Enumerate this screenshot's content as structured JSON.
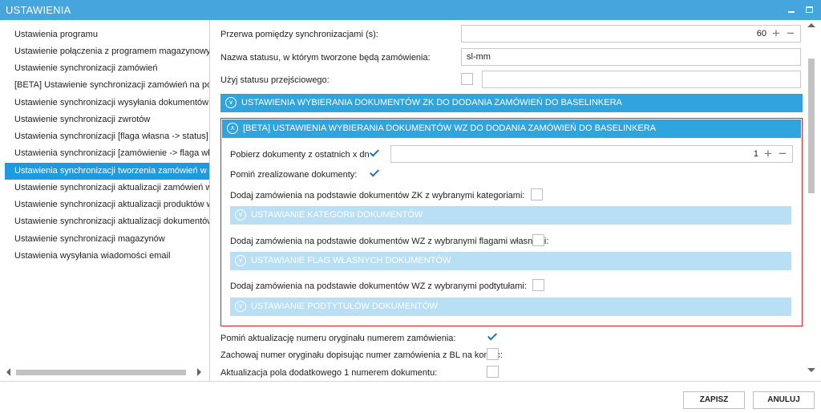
{
  "window": {
    "title": "USTAWIENIA"
  },
  "sidebar": {
    "items": [
      {
        "label": "Ustawienia programu"
      },
      {
        "label": "Ustawienie połączenia z programem magazynowym"
      },
      {
        "label": "Ustawienie synchronizacji zamówień"
      },
      {
        "label": "[BETA] Ustawienie synchronizacji zamówień na podsta"
      },
      {
        "label": "Ustawienie synchronizacji wysyłania dokumentów"
      },
      {
        "label": "Ustawienie synchronizacji zwrotów"
      },
      {
        "label": "Ustawienia synchronizacji [flaga własna -> status]"
      },
      {
        "label": "Ustawienia synchronizacji [zamówienie -> flaga własn"
      },
      {
        "label": "Ustawienia synchronizacji tworzenia zamówień w Base"
      },
      {
        "label": "Ustawienie synchronizacji aktualizacji zamówień w Bas"
      },
      {
        "label": "Ustawienie synchronizacji aktualizacji produktów w Ba"
      },
      {
        "label": "Ustawienie synchronizacji aktualizacji dokumentów"
      },
      {
        "label": "Ustawienie synchronizacji magazynów"
      },
      {
        "label": "Ustawienia wysyłania wiadomości email"
      }
    ],
    "active_index": 8
  },
  "main": {
    "sync_interval": {
      "label": "Przerwa pomiędzy synchronizacjami (s):",
      "value": "60"
    },
    "status_name": {
      "label": "Nazwa statusu, w którym tworzone będą zamówienia:",
      "value": "sl-mm"
    },
    "transitional_status": {
      "label": "Użyj statusu przejściowego:",
      "checked": false,
      "value": ""
    },
    "zk_section": {
      "title": "USTAWIENIA WYBIERANIA DOKUMENTÓW ZK DO DODANIA ZAMÓWIEŃ DO BASELINKERA"
    },
    "wz_section": {
      "title": "[BETA] USTAWIENIA WYBIERANIA DOKUMENTÓW WZ DO DODANIA ZAMÓWIEŃ DO BASELINKERA",
      "fetch_days": {
        "label": "Pobierz dokumenty z ostatnich x dni:",
        "checked": true,
        "value": "1"
      },
      "skip_completed": {
        "label": "Pomiń zrealizowane dokumenty:",
        "checked": true
      },
      "zk_categories": {
        "label": "Dodaj zamówienia na podstawie dokumentów ZK z wybranymi kategoriami:",
        "checked": false
      },
      "categories_bar": "USTAWIANIE KATEGORII DOKUMENTÓW",
      "wz_flags": {
        "label": "Dodaj zamówienia na podstawie dokumentów WZ z wybranymi flagami własnymi:",
        "checked": false
      },
      "flags_bar": "USTAWIANIE FLAG WŁASNYCH DOKUMENTÓW",
      "wz_subtitles": {
        "label": "Dodaj zamówienia na podstawie dokumentów WZ z wybranymi podtytułami:",
        "checked": false
      },
      "subtitles_bar": "USTAWIANIE PODTYTUŁÓW DOKUMENTÓW"
    },
    "skip_original_update": {
      "label": "Pomiń aktualizację numeru oryginału numerem zamówienia:",
      "checked": true
    },
    "keep_original_number": {
      "label": "Zachowaj numer oryginału dopisując numer zamówienia z BL na koniec:",
      "checked": false
    },
    "update_extra_field": {
      "label": "Aktualizacja pola dodatkowego 1 numerem dokumentu:",
      "checked": false
    }
  },
  "footer": {
    "save_label": "ZAPISZ",
    "cancel_label": "ANULUJ"
  },
  "colors": {
    "titlebar": "#45a5dd",
    "section": "#30a4dd",
    "section_light": "#b8dff4",
    "active_item": "#1e9be0",
    "highlight_border": "#e02020"
  }
}
